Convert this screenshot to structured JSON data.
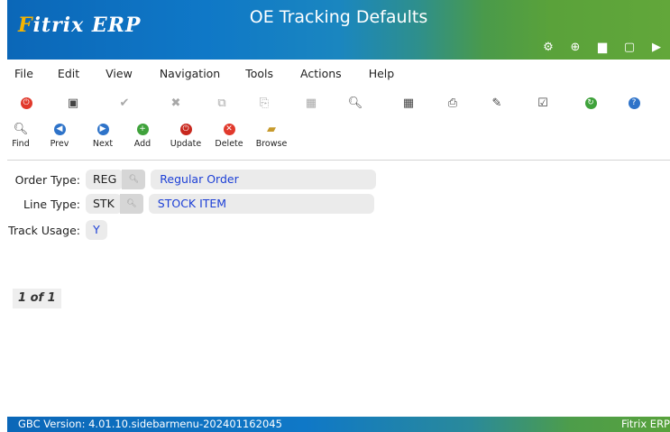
{
  "header": {
    "logo_prefix": "F",
    "logo_text": "itrix ERP",
    "title": "OE Tracking Defaults",
    "icons": [
      "gear-icon",
      "globe-icon",
      "document-icon",
      "new-page-icon",
      "play-icon"
    ]
  },
  "menu": {
    "items": [
      {
        "label": "File"
      },
      {
        "label": "Edit"
      },
      {
        "label": "View"
      },
      {
        "label": "Navigation"
      },
      {
        "label": "Tools"
      },
      {
        "label": "Actions"
      },
      {
        "label": "Help"
      }
    ]
  },
  "toolbar": {
    "icons": [
      "power-icon",
      "save-icon",
      "accept-icon",
      "cancel-icon",
      "copy-icon",
      "paste-icon",
      "grid-icon",
      "zoom-icon",
      "calendar-icon",
      "attach-icon",
      "edit-doc-icon",
      "checklist-icon",
      "refresh-icon",
      "help-icon"
    ]
  },
  "nav": {
    "find": "Find",
    "prev": "Prev",
    "next": "Next",
    "add": "Add",
    "update": "Update",
    "delete": "Delete",
    "browse": "Browse"
  },
  "form": {
    "order_type": {
      "label": "Order Type:",
      "code": "REG",
      "desc": "Regular Order"
    },
    "line_type": {
      "label": "Line Type:",
      "code": "STK",
      "desc": "STOCK ITEM"
    },
    "track_usage": {
      "label": "Track Usage:",
      "value": "Y"
    }
  },
  "pager": {
    "text": "1 of 1"
  },
  "status": {
    "version": "GBC Version: 4.01.10.sidebarmenu-202401162045",
    "brand": "Fitrix ERP"
  },
  "colors": {
    "header_blue": "#0f78c7",
    "header_green": "#62a73a",
    "value_blue": "#1c3fd6"
  }
}
